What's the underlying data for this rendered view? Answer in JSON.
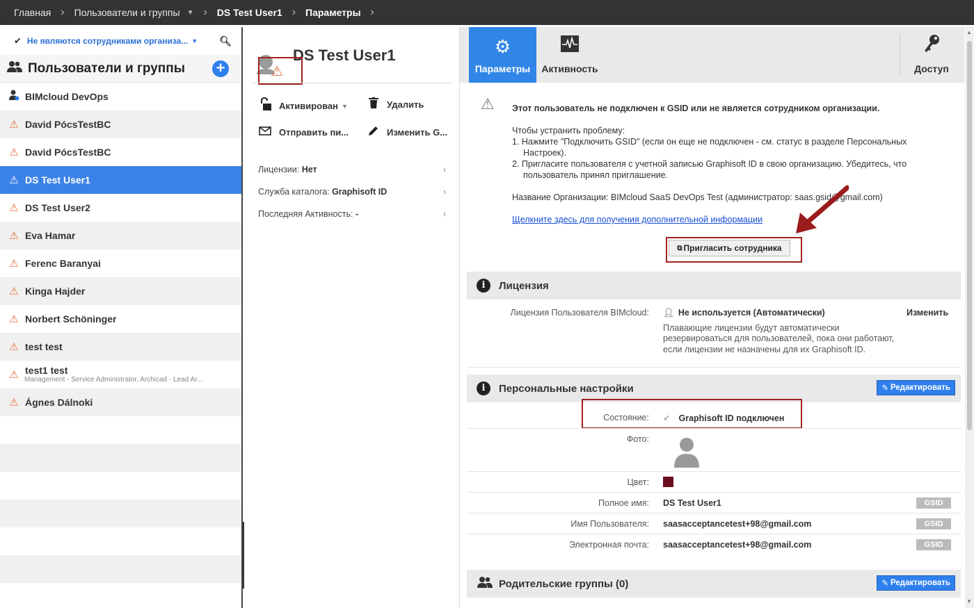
{
  "breadcrumb": {
    "home": "Главная",
    "users_groups": "Пользователи и группы",
    "user": "DS Test User1",
    "params": "Параметры"
  },
  "left": {
    "filter": "Не являются сотрудниками организа...",
    "title": "Пользователи и группы",
    "items": [
      {
        "name": "BIMcloud DevOps",
        "sub": ""
      },
      {
        "name": "David PócsTestBC",
        "sub": ""
      },
      {
        "name": "David PócsTestBC",
        "sub": ""
      },
      {
        "name": "DS Test User1",
        "sub": ""
      },
      {
        "name": "DS Test User2",
        "sub": ""
      },
      {
        "name": "Eva Hamar",
        "sub": ""
      },
      {
        "name": "Ferenc Baranyai",
        "sub": ""
      },
      {
        "name": "Kinga Hajder",
        "sub": ""
      },
      {
        "name": "Norbert Schöninger",
        "sub": ""
      },
      {
        "name": "test test",
        "sub": ""
      },
      {
        "name": "test1 test",
        "sub": "Management - Service Administrator, Archicad - Lead Ar..."
      },
      {
        "name": "Ágnes Dálnoki",
        "sub": ""
      }
    ]
  },
  "middle": {
    "title": "DS Test User1",
    "actions": {
      "activated": "Активирован",
      "delete": "Удалить",
      "send": "Отправить пи...",
      "change": "Изменить G..."
    },
    "licenses_label": "Лицензии:",
    "licenses_value": "Нет",
    "catalog_label": "Служба каталога:",
    "catalog_value": "Graphisoft ID",
    "last_activity_label": "Последняя Активность:",
    "last_activity_value": "-"
  },
  "tabs": {
    "params": "Параметры",
    "activity": "Активность",
    "access": "Доступ"
  },
  "warning": {
    "title": "Этот пользователь не подключен к GSID или не является сотрудником организации.",
    "intro": "Чтобы устранить проблему:",
    "step1a": "1. Нажмите \"Подключить GSID\" (если он еще не подключен - см. статус в разделе Персональных",
    "step1b": "Настроек).",
    "step2a": "2. Пригласите пользователя с учетной записью Graphisoft ID в свою организацию. Убедитесь, что",
    "step2b": "пользователь принял приглашение.",
    "org": "Название Организации: BIMcloud SaaS DevOps Test (администратор: saas.gsid@gmail.com)",
    "link": "Щелкните здесь для получения дополнительной информации",
    "invite": "Пригласить сотрудника"
  },
  "license": {
    "head": "Лицензия",
    "label": "Лицензия Пользователя BIMcloud:",
    "value": "Не используется (Автоматически)",
    "change": "Изменить",
    "desc1": "Плавающие лицензии будут автоматически",
    "desc2": "резервироваться для пользователей, пока они работают,",
    "desc3": "если лицензии не назначены для их Graphisoft ID."
  },
  "personal": {
    "head": "Персональные настройки",
    "edit": "Редактировать",
    "state_label": "Состояние:",
    "state_value": "Graphisoft ID подключен",
    "photo_label": "Фото:",
    "color_label": "Цвет:",
    "fullname_label": "Полное имя:",
    "fullname_value": "DS Test User1",
    "username_label": "Имя Пользователя:",
    "username_value": "saasacceptancetest+98@gmail.com",
    "email_label": "Электронная почта:",
    "email_value": "saasacceptancetest+98@gmail.com",
    "gsid": "GSID",
    "color": "#6b0e1f"
  },
  "parents": {
    "head": "Родительские группы (0)",
    "edit": "Редактировать"
  }
}
